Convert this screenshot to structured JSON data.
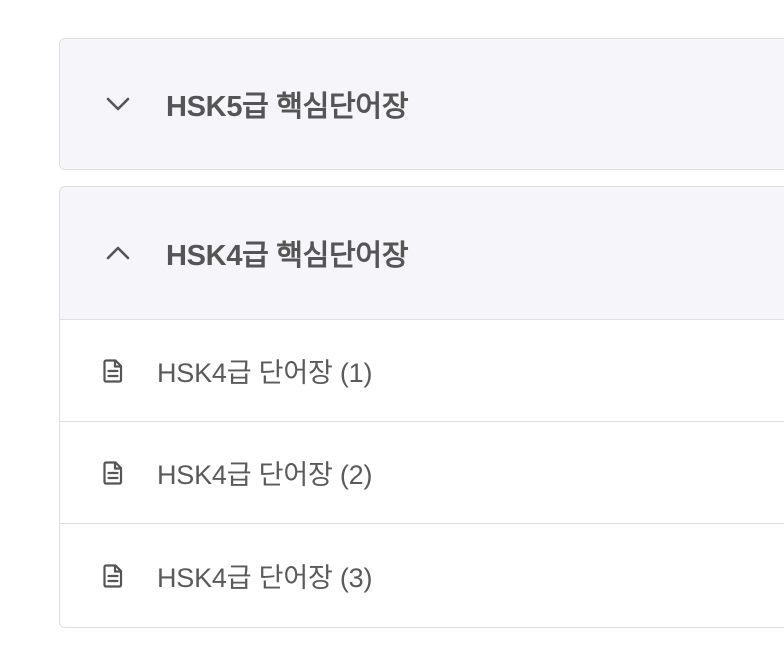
{
  "accordions": [
    {
      "title": "HSK5급 핵심단어장",
      "expanded": false,
      "chevron_icon": "chevron-down-icon",
      "items": []
    },
    {
      "title": "HSK4급 핵심단어장",
      "expanded": true,
      "chevron_icon": "chevron-up-icon",
      "items": [
        {
          "label": "HSK4급 단어장 (1)",
          "icon": "document-icon"
        },
        {
          "label": "HSK4급 단어장 (2)",
          "icon": "document-icon"
        },
        {
          "label": "HSK4급 단어장 (3)",
          "icon": "document-icon"
        }
      ]
    }
  ],
  "colors": {
    "header_bg": "#f6f6fa",
    "border": "#dedee3",
    "title_text": "#555555",
    "item_text": "#5a5a5a",
    "icon": "#555555"
  }
}
